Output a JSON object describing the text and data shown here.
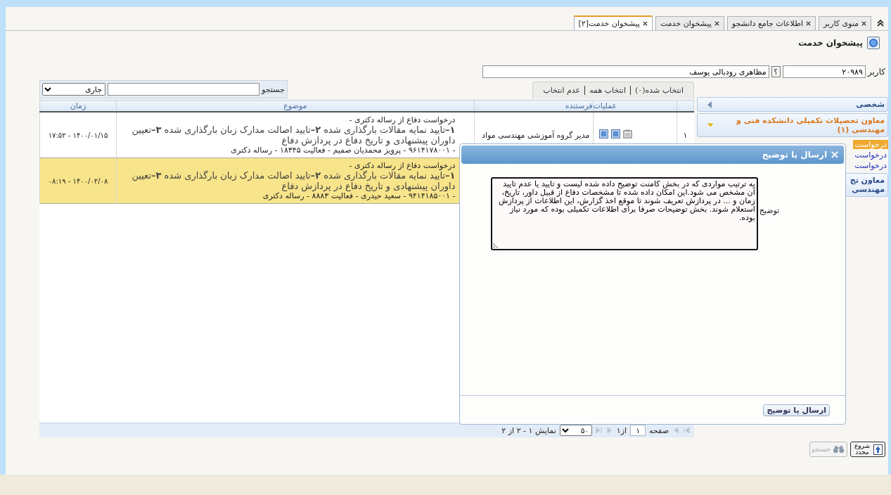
{
  "tabs": [
    {
      "label": "منوی کاربر",
      "selected": false
    },
    {
      "label": "اطلاعات جامع دانشجو",
      "selected": false
    },
    {
      "label": "پیشخوان خدمت",
      "selected": false
    },
    {
      "label": "پیشخوان خدمت[۲]",
      "selected": true
    }
  ],
  "page_title": "پیشخوان خدمت",
  "user": {
    "label": "کاربر",
    "code": "۲۰۹۸۹",
    "lookup": "؟",
    "name": "مظاهری رودبالی یوسف"
  },
  "toolbar": {
    "links": [
      "انتخاب شده(۰)",
      "انتخاب همه",
      "عدم انتخاب"
    ],
    "search_label": "جستجو",
    "filter": "جاری"
  },
  "table": {
    "columns": [
      "عملیات",
      "فرستنده",
      "موضوع",
      "زمان"
    ],
    "rows": [
      {
        "number": "۱",
        "selected": false,
        "sender": "مدیر گروه آموزشی مهندسی مواد",
        "subject_title": "درخواست دفاع از رساله دکتری -",
        "subject_body": "**۱–**تایید نمایه مقالات بارگذاری شده **۲–**تایید اصالت مدارک زبان بارگذاری شده **۳–**تعیین داوران پیشنهادی و تاریخ دفاع در پردازش دفاع",
        "subject_meta": "- ۹۶۱۴۱۷۸۰۰۱ - پرویز محمدیان صمیم - فعالیت ۱۸۳۴۵ - رساله دکتری",
        "time": "۱۴۰۰/۰۱/۱۵ - ۱۷:۵۲"
      },
      {
        "selected": true,
        "subject_title": "درخواست دفاع از رساله دکتری -",
        "subject_body": "**۱–**تایید نمایه مقالات بارگذاری شده **۲–**تایید اصالت مدارک زبان بارگذاری شده **۳–**تعیین داوران پیشنهادی و تاریخ دفاع در پردازش دفاع",
        "subject_meta": "- ۹۴۱۴۱۸۵۰۰۱ - سعید حیدری - فعالیت ۸۸۸۳ - رساله دکتری",
        "time": "۱۴۰۰/۰۲/۰۸ - ۰۸:۱۹"
      }
    ]
  },
  "pager": {
    "page_label": "صفحه",
    "page": "۱",
    "of": "از۱",
    "page_size": "۵۰",
    "summary": "نمایش ۱ - ۲ از ۲"
  },
  "sidebar": [
    {
      "title": "شخصی",
      "expanded": false
    },
    {
      "title": "معاون تحصیلات تکمیلی دانشکده فنی و مهندسی (۱)",
      "expanded": true,
      "items": [
        {
          "label": "درخواست",
          "selected": true
        },
        {
          "label": "درخواست",
          "selected": false
        },
        {
          "label": "درخواست",
          "selected": false
        }
      ]
    },
    {
      "title": "معاون تح",
      "subtitle": "مهندسی",
      "expanded": false
    }
  ],
  "dialog": {
    "title": "ارسال یا توضیح",
    "field_label": "توضیح",
    "text": "به ترتیب مواردی که در بخش کامنت توضیح داده شده لیست و تایید یا عدم تایید آن مشخص می شود.این امکان داده شده تا مشخصات دفاع از قبیل داور، تاریخ، زمان و ... در پردازش تعریف شوند تا موقع اخذ گزارش، این اطلاعات از پردازش استعلام شوند. بخش توضیحات صرفا برای اطلاعات تکمیلی بوده که مورد نیاز بوده.",
    "button": "ارسال یا توضیح"
  },
  "footer_buttons": [
    {
      "label": "شروع مجدد",
      "disabled": false
    },
    {
      "label": "جستجو",
      "disabled": true
    }
  ]
}
